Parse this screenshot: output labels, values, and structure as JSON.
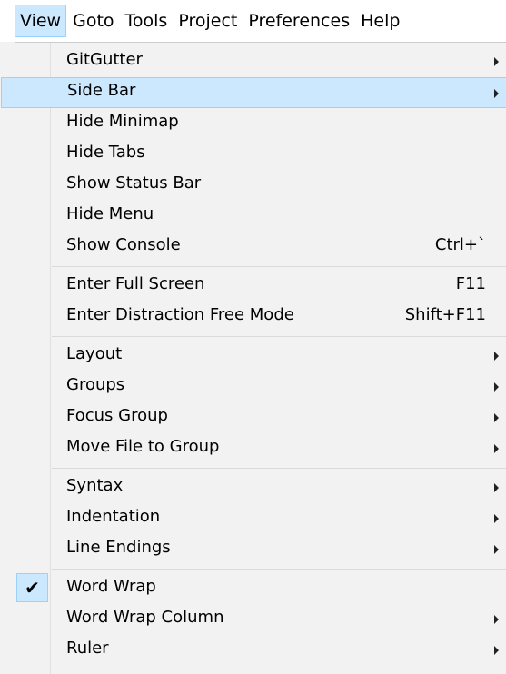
{
  "menubar": {
    "items": [
      {
        "label": "View",
        "active": true
      },
      {
        "label": "Goto",
        "active": false
      },
      {
        "label": "Tools",
        "active": false
      },
      {
        "label": "Project",
        "active": false
      },
      {
        "label": "Preferences",
        "active": false
      },
      {
        "label": "Help",
        "active": false
      }
    ]
  },
  "view_menu": {
    "groups": [
      [
        {
          "label": "GitGutter",
          "submenu": true
        },
        {
          "label": "Side Bar",
          "submenu": true,
          "highlighted": true
        },
        {
          "label": "Hide Minimap"
        },
        {
          "label": "Hide Tabs"
        },
        {
          "label": "Show Status Bar"
        },
        {
          "label": "Hide Menu"
        },
        {
          "label": "Show Console",
          "shortcut": "Ctrl+`"
        }
      ],
      [
        {
          "label": "Enter Full Screen",
          "shortcut": "F11"
        },
        {
          "label": "Enter Distraction Free Mode",
          "shortcut": "Shift+F11"
        }
      ],
      [
        {
          "label": "Layout",
          "submenu": true
        },
        {
          "label": "Groups",
          "submenu": true
        },
        {
          "label": "Focus Group",
          "submenu": true
        },
        {
          "label": "Move File to Group",
          "submenu": true
        }
      ],
      [
        {
          "label": "Syntax",
          "submenu": true
        },
        {
          "label": "Indentation",
          "submenu": true
        },
        {
          "label": "Line Endings",
          "submenu": true
        }
      ],
      [
        {
          "label": "Word Wrap",
          "checked": true,
          "check_glyph": "✔"
        },
        {
          "label": "Word Wrap Column",
          "submenu": true
        },
        {
          "label": "Ruler",
          "submenu": true
        }
      ]
    ]
  }
}
